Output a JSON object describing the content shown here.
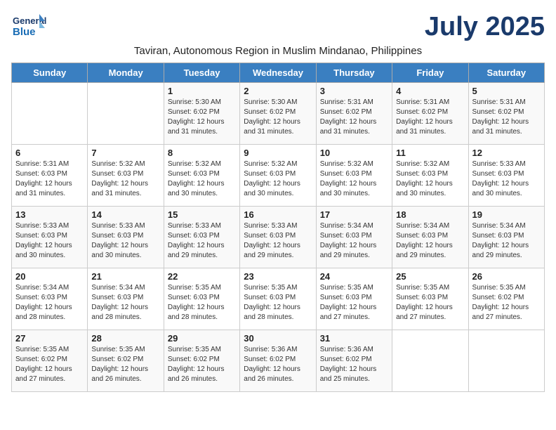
{
  "logo": {
    "general": "General",
    "blue": "Blue"
  },
  "title": "July 2025",
  "subtitle": "Taviran, Autonomous Region in Muslim Mindanao, Philippines",
  "days_of_week": [
    "Sunday",
    "Monday",
    "Tuesday",
    "Wednesday",
    "Thursday",
    "Friday",
    "Saturday"
  ],
  "weeks": [
    [
      null,
      null,
      {
        "day": "1",
        "sunrise": "Sunrise: 5:30 AM",
        "sunset": "Sunset: 6:02 PM",
        "daylight": "Daylight: 12 hours and 31 minutes."
      },
      {
        "day": "2",
        "sunrise": "Sunrise: 5:30 AM",
        "sunset": "Sunset: 6:02 PM",
        "daylight": "Daylight: 12 hours and 31 minutes."
      },
      {
        "day": "3",
        "sunrise": "Sunrise: 5:31 AM",
        "sunset": "Sunset: 6:02 PM",
        "daylight": "Daylight: 12 hours and 31 minutes."
      },
      {
        "day": "4",
        "sunrise": "Sunrise: 5:31 AM",
        "sunset": "Sunset: 6:02 PM",
        "daylight": "Daylight: 12 hours and 31 minutes."
      },
      {
        "day": "5",
        "sunrise": "Sunrise: 5:31 AM",
        "sunset": "Sunset: 6:02 PM",
        "daylight": "Daylight: 12 hours and 31 minutes."
      }
    ],
    [
      {
        "day": "6",
        "sunrise": "Sunrise: 5:31 AM",
        "sunset": "Sunset: 6:03 PM",
        "daylight": "Daylight: 12 hours and 31 minutes."
      },
      {
        "day": "7",
        "sunrise": "Sunrise: 5:32 AM",
        "sunset": "Sunset: 6:03 PM",
        "daylight": "Daylight: 12 hours and 31 minutes."
      },
      {
        "day": "8",
        "sunrise": "Sunrise: 5:32 AM",
        "sunset": "Sunset: 6:03 PM",
        "daylight": "Daylight: 12 hours and 30 minutes."
      },
      {
        "day": "9",
        "sunrise": "Sunrise: 5:32 AM",
        "sunset": "Sunset: 6:03 PM",
        "daylight": "Daylight: 12 hours and 30 minutes."
      },
      {
        "day": "10",
        "sunrise": "Sunrise: 5:32 AM",
        "sunset": "Sunset: 6:03 PM",
        "daylight": "Daylight: 12 hours and 30 minutes."
      },
      {
        "day": "11",
        "sunrise": "Sunrise: 5:32 AM",
        "sunset": "Sunset: 6:03 PM",
        "daylight": "Daylight: 12 hours and 30 minutes."
      },
      {
        "day": "12",
        "sunrise": "Sunrise: 5:33 AM",
        "sunset": "Sunset: 6:03 PM",
        "daylight": "Daylight: 12 hours and 30 minutes."
      }
    ],
    [
      {
        "day": "13",
        "sunrise": "Sunrise: 5:33 AM",
        "sunset": "Sunset: 6:03 PM",
        "daylight": "Daylight: 12 hours and 30 minutes."
      },
      {
        "day": "14",
        "sunrise": "Sunrise: 5:33 AM",
        "sunset": "Sunset: 6:03 PM",
        "daylight": "Daylight: 12 hours and 30 minutes."
      },
      {
        "day": "15",
        "sunrise": "Sunrise: 5:33 AM",
        "sunset": "Sunset: 6:03 PM",
        "daylight": "Daylight: 12 hours and 29 minutes."
      },
      {
        "day": "16",
        "sunrise": "Sunrise: 5:33 AM",
        "sunset": "Sunset: 6:03 PM",
        "daylight": "Daylight: 12 hours and 29 minutes."
      },
      {
        "day": "17",
        "sunrise": "Sunrise: 5:34 AM",
        "sunset": "Sunset: 6:03 PM",
        "daylight": "Daylight: 12 hours and 29 minutes."
      },
      {
        "day": "18",
        "sunrise": "Sunrise: 5:34 AM",
        "sunset": "Sunset: 6:03 PM",
        "daylight": "Daylight: 12 hours and 29 minutes."
      },
      {
        "day": "19",
        "sunrise": "Sunrise: 5:34 AM",
        "sunset": "Sunset: 6:03 PM",
        "daylight": "Daylight: 12 hours and 29 minutes."
      }
    ],
    [
      {
        "day": "20",
        "sunrise": "Sunrise: 5:34 AM",
        "sunset": "Sunset: 6:03 PM",
        "daylight": "Daylight: 12 hours and 28 minutes."
      },
      {
        "day": "21",
        "sunrise": "Sunrise: 5:34 AM",
        "sunset": "Sunset: 6:03 PM",
        "daylight": "Daylight: 12 hours and 28 minutes."
      },
      {
        "day": "22",
        "sunrise": "Sunrise: 5:35 AM",
        "sunset": "Sunset: 6:03 PM",
        "daylight": "Daylight: 12 hours and 28 minutes."
      },
      {
        "day": "23",
        "sunrise": "Sunrise: 5:35 AM",
        "sunset": "Sunset: 6:03 PM",
        "daylight": "Daylight: 12 hours and 28 minutes."
      },
      {
        "day": "24",
        "sunrise": "Sunrise: 5:35 AM",
        "sunset": "Sunset: 6:03 PM",
        "daylight": "Daylight: 12 hours and 27 minutes."
      },
      {
        "day": "25",
        "sunrise": "Sunrise: 5:35 AM",
        "sunset": "Sunset: 6:03 PM",
        "daylight": "Daylight: 12 hours and 27 minutes."
      },
      {
        "day": "26",
        "sunrise": "Sunrise: 5:35 AM",
        "sunset": "Sunset: 6:02 PM",
        "daylight": "Daylight: 12 hours and 27 minutes."
      }
    ],
    [
      {
        "day": "27",
        "sunrise": "Sunrise: 5:35 AM",
        "sunset": "Sunset: 6:02 PM",
        "daylight": "Daylight: 12 hours and 27 minutes."
      },
      {
        "day": "28",
        "sunrise": "Sunrise: 5:35 AM",
        "sunset": "Sunset: 6:02 PM",
        "daylight": "Daylight: 12 hours and 26 minutes."
      },
      {
        "day": "29",
        "sunrise": "Sunrise: 5:35 AM",
        "sunset": "Sunset: 6:02 PM",
        "daylight": "Daylight: 12 hours and 26 minutes."
      },
      {
        "day": "30",
        "sunrise": "Sunrise: 5:36 AM",
        "sunset": "Sunset: 6:02 PM",
        "daylight": "Daylight: 12 hours and 26 minutes."
      },
      {
        "day": "31",
        "sunrise": "Sunrise: 5:36 AM",
        "sunset": "Sunset: 6:02 PM",
        "daylight": "Daylight: 12 hours and 25 minutes."
      },
      null,
      null
    ]
  ]
}
